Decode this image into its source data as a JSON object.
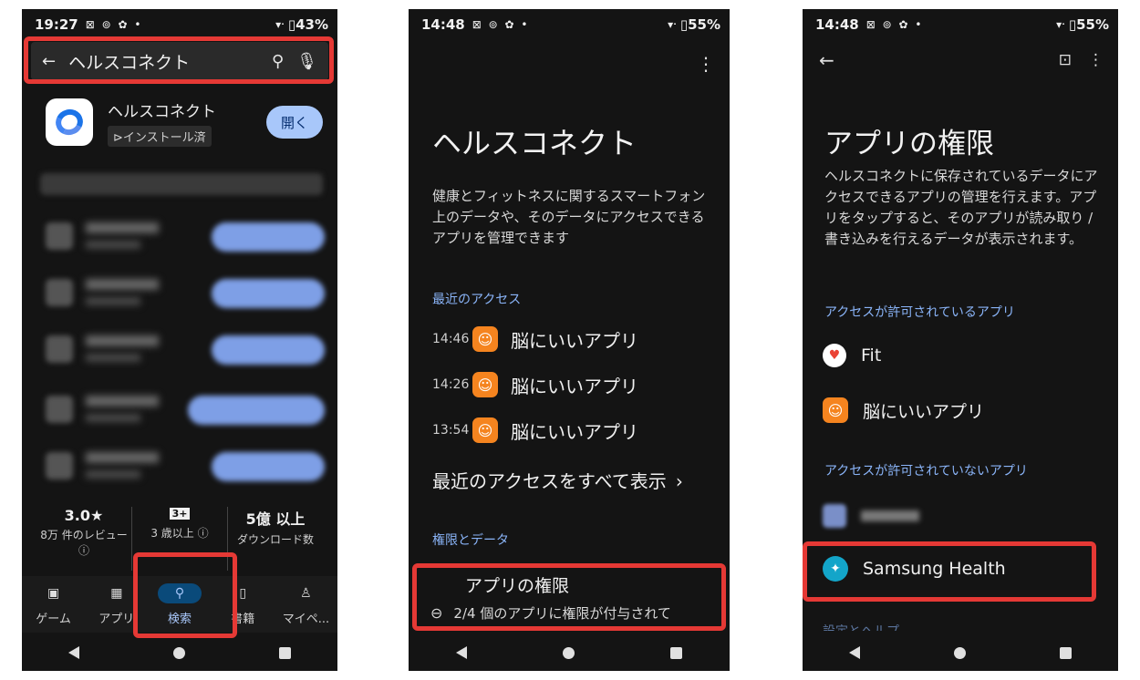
{
  "screen1": {
    "status": {
      "time": "19:27",
      "icons": "⊠ ⊚ ✿ •",
      "wifi": "▾ᐧ",
      "battery": "▯43%"
    },
    "search": {
      "query": "ヘルスコネクト"
    },
    "app": {
      "name": "ヘルスコネクト",
      "badge": "⊳インストール済",
      "open_label": "開く"
    },
    "stats": {
      "rating": "3.0★",
      "reviews": "8万 件のレビュー ⓘ",
      "age_badge": "3+",
      "age": "3 歳以上 ⓘ",
      "downloads": "5億 以上",
      "downloads_label": "ダウンロード数"
    },
    "tabs": [
      {
        "label": "ゲーム",
        "icon": "▣"
      },
      {
        "label": "アプリ",
        "icon": "▦"
      },
      {
        "label": "検索",
        "icon": "⚲"
      },
      {
        "label": "書籍",
        "icon": "▯"
      },
      {
        "label": "マイペ...",
        "icon": "♙"
      }
    ]
  },
  "screen2": {
    "status": {
      "time": "14:48",
      "icons": "⊠ ⊚ ✿ •",
      "wifi": "▾ᐧ",
      "battery": "▯55%"
    },
    "title": "ヘルスコネクト",
    "description": "健康とフィットネスに関するスマートフォン上のデータや、そのデータにアクセスできるアプリを管理できます",
    "recent_heading": "最近のアクセス",
    "recent": [
      {
        "time": "14:46",
        "app": "脳にいいアプリ"
      },
      {
        "time": "14:26",
        "app": "脳にいいアプリ"
      },
      {
        "time": "13:54",
        "app": "脳にいいアプリ"
      }
    ],
    "see_all": "最近のアクセスをすべて表示",
    "perm_heading": "権限とデータ",
    "perm_title": "アプリの権限",
    "perm_sub": "2/4 個のアプリに権限が付与されて"
  },
  "screen3": {
    "status": {
      "time": "14:48",
      "icons": "⊠ ⊚ ✿ •",
      "wifi": "▾ᐧ",
      "battery": "▯55%"
    },
    "title": "アプリの権限",
    "description": "ヘルスコネクトに保存されているデータにアクセスできるアプリの管理を行えます。アプリをタップすると、そのアプリが読み取り / 書き込みを行えるデータが表示されます。",
    "allowed_heading": "アクセスが許可されているアプリ",
    "allowed": [
      {
        "name": "Fit"
      },
      {
        "name": "脳にいいアプリ"
      }
    ],
    "denied_heading": "アクセスが許可されていないアプリ",
    "denied": [
      {
        "name": "Samsung Health"
      }
    ],
    "next_heading": "設定とヘルプ"
  },
  "colors": {
    "highlight": "#e53935",
    "link": "#8ab4f8",
    "accent_button": "#a8c7fa"
  }
}
